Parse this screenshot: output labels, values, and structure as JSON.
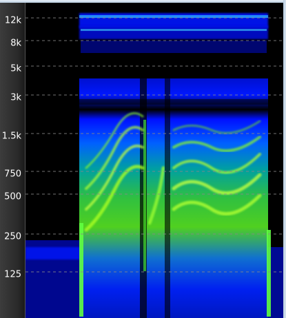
{
  "spectrogram": {
    "y_axis_labels": [
      "12k",
      "8k",
      "5k",
      "3k",
      "1.5k",
      "750",
      "500",
      "250",
      "125"
    ],
    "colors": {
      "background": "#000000",
      "low_intensity": "#0010ff",
      "mid_intensity": "#00c8c8",
      "high_intensity": "#7cff00",
      "gridline": "#888888"
    }
  }
}
